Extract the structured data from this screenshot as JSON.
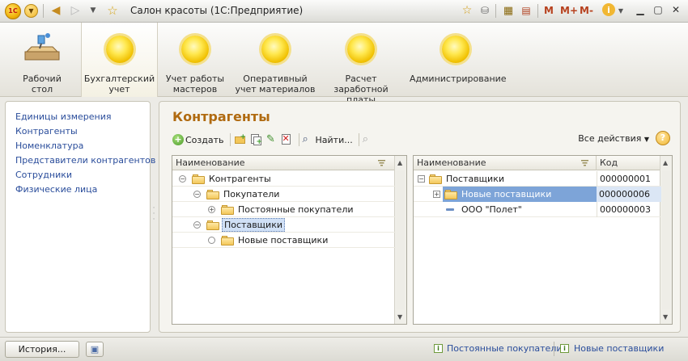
{
  "app": {
    "title": "Салон красоты  (1С:Предприятие)",
    "logo_text": "1С",
    "m_buttons": [
      "M",
      "M+",
      "M-"
    ],
    "accent_color": "#b06a10"
  },
  "sections": [
    {
      "label": "Рабочий\nстол",
      "icon": "desktop-icon"
    },
    {
      "label": "Бухгалтерский\nучет",
      "icon": "section-icon",
      "active": true
    },
    {
      "label": "Учет работы\nмастеров",
      "icon": "section-icon"
    },
    {
      "label": "Оперативный\nучет материалов",
      "icon": "section-icon"
    },
    {
      "label": "Расчет\nзаработной платы",
      "icon": "section-icon"
    },
    {
      "label": "Администрирование",
      "icon": "section-icon"
    }
  ],
  "nav": {
    "items": [
      "Единицы измерения",
      "Контрагенты",
      "Номенклатура",
      "Представители контрагентов",
      "Сотрудники",
      "Физические лица"
    ]
  },
  "form": {
    "title": "Контрагенты",
    "toolbar": {
      "create_label": "Создать",
      "find_label": "Найти...",
      "all_actions_label": "Все действия",
      "help_label": "?"
    }
  },
  "tree_table": {
    "header": "Наименование",
    "rows": [
      {
        "label": "Контрагенты",
        "expander": "−"
      },
      {
        "label": "Покупатели",
        "expander": "−"
      },
      {
        "label": "Постоянные покупатели",
        "expander": "+"
      },
      {
        "label": "Поставщики",
        "expander": "−",
        "selected": true
      },
      {
        "label": "Новые поставщики",
        "expander": ""
      }
    ]
  },
  "list_table": {
    "headers": [
      "Наименование",
      "Код"
    ],
    "rows": [
      {
        "name": "Поставщики",
        "code": "000000001",
        "expander": "−",
        "type": "folder"
      },
      {
        "name": "Новые поставщики",
        "code": "000000006",
        "expander": "+",
        "type": "folder",
        "selected": true
      },
      {
        "name": "ООО \"Полет\"",
        "code": "000000003",
        "expander": "",
        "type": "item"
      }
    ]
  },
  "statusbar": {
    "history_label": "История...",
    "links": [
      "Постоянные покупатели",
      "Новые поставщики"
    ]
  }
}
